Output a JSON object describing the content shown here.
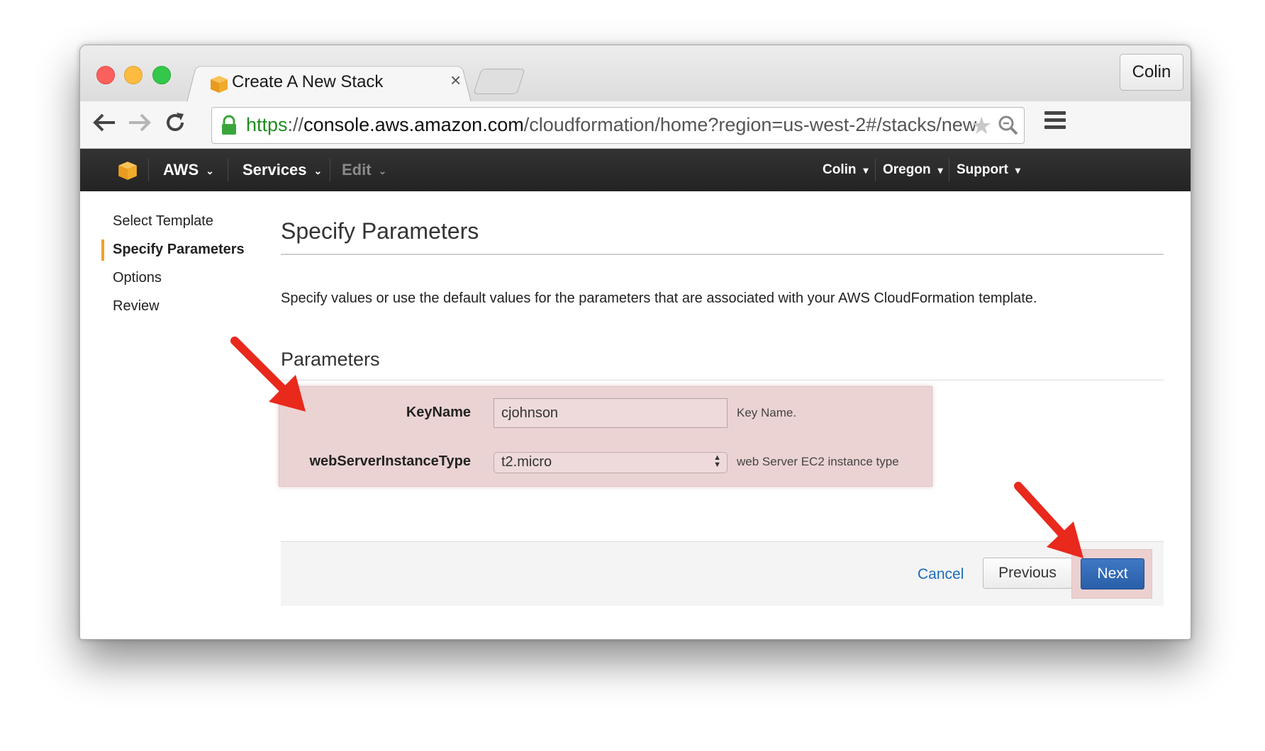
{
  "browser": {
    "tab_title": "Create A New Stack",
    "tab_close": "×",
    "profile": "Colin",
    "url": {
      "scheme": "https",
      "separator": "://",
      "host": "console.aws.amazon.com",
      "path": "/cloudformation/home?region=us-west-2#/stacks/new"
    }
  },
  "aws_nav": {
    "brand": "AWS",
    "services": "Services",
    "edit": "Edit",
    "user": "Colin",
    "region": "Oregon",
    "support": "Support",
    "caret": "▾"
  },
  "steps": [
    {
      "label": "Select Template"
    },
    {
      "label": "Specify Parameters"
    },
    {
      "label": "Options"
    },
    {
      "label": "Review"
    }
  ],
  "main": {
    "title": "Specify Parameters",
    "description": "Specify values or use the default values for the parameters that are associated with your AWS CloudFormation template.",
    "section_title": "Parameters",
    "params": [
      {
        "label": "KeyName",
        "value": "cjohnson",
        "help": "Key Name."
      },
      {
        "label": "webServerInstanceType",
        "value": "t2.micro",
        "help": "web Server EC2 instance type"
      }
    ]
  },
  "footer": {
    "cancel": "Cancel",
    "previous": "Previous",
    "next": "Next"
  },
  "colors": {
    "highlight": "#ebd3d3",
    "annotation_arrow": "#e8291c",
    "next_button": "#2a5ea8",
    "active_step_marker": "#f0a030"
  }
}
